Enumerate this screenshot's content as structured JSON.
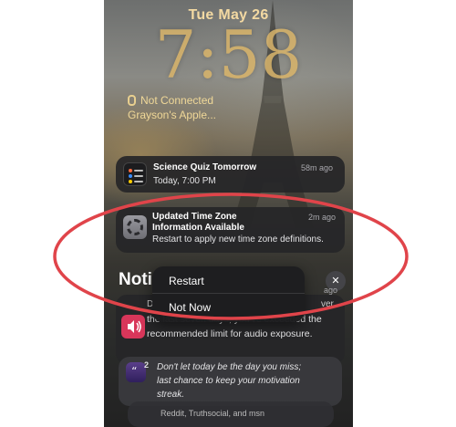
{
  "lockscreen": {
    "date": "Tue May 26",
    "time": "7:58",
    "connection_status": "Not Connected",
    "device_name": "Grayson's Apple..."
  },
  "notifications": [
    {
      "app_icon": "reminders-icon",
      "title": "Science Quiz Tomorrow",
      "body": "Today, 7:00 PM",
      "ago": "58m ago"
    },
    {
      "app_icon": "settings-gear-icon",
      "title": "Updated Time Zone",
      "title_line2": "Information Available",
      "body": "Restart to apply new time zone definitions.",
      "ago": "2m ago"
    }
  ],
  "notification_center": {
    "heading": "Noti",
    "close_icon": "close-icon"
  },
  "older_notifications": [
    {
      "app_icon": "speaker-icon",
      "ago": "ago",
      "lines": [
        "D",
        "ver",
        "the last seven days, you've exceeded the",
        "recommended limit for audio exposure."
      ]
    },
    {
      "app_icon": "motivation-app-icon",
      "badge": "2",
      "lines": [
        "Don't let today be the day you miss;",
        "last chance to keep your motivation",
        "streak."
      ]
    },
    {
      "lines": [
        "Reddit, Truthsocial, and msn"
      ]
    }
  ],
  "context_menu": {
    "items": [
      "Restart",
      "Not Now"
    ]
  },
  "annotation_color": "#e0444a"
}
